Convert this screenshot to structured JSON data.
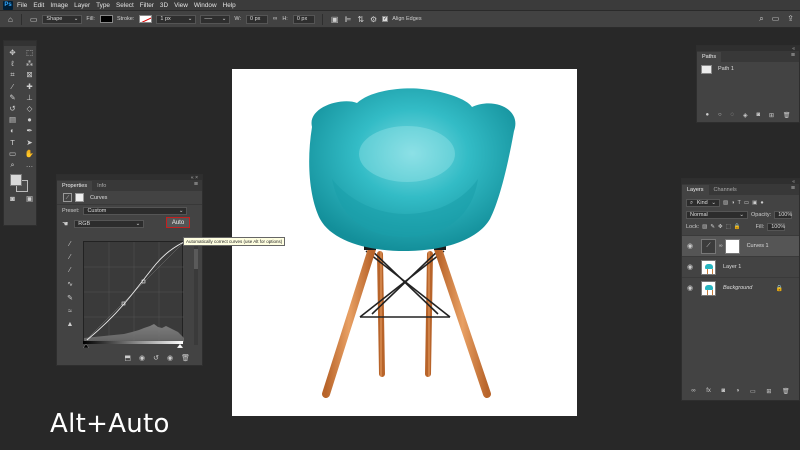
{
  "menubar": {
    "logo": "Ps",
    "items": [
      "File",
      "Edit",
      "Image",
      "Layer",
      "Type",
      "Select",
      "Filter",
      "3D",
      "View",
      "Window",
      "Help"
    ]
  },
  "options_bar": {
    "tool_mode": "Shape",
    "fill_label": "Fill:",
    "stroke_label": "Stroke:",
    "stroke_width": "1 px",
    "w_label": "W:",
    "w_value": "0 px",
    "h_label": "H:",
    "h_value": "0 px",
    "align_edges": "Align Edges"
  },
  "properties": {
    "tabs": [
      "Properties",
      "Info"
    ],
    "title": "Curves",
    "preset_label": "Preset:",
    "preset_value": "Custom",
    "channel": "RGB",
    "auto_button": "Auto",
    "tooltip": "Automatically correct curves (use Alt for options)"
  },
  "paths": {
    "title": "Paths",
    "items": [
      "Path 1"
    ]
  },
  "layers": {
    "tabs": [
      "Layers",
      "Channels"
    ],
    "filter": "Kind",
    "blend_mode": "Normal",
    "opacity_label": "Opacity:",
    "opacity_value": "100%",
    "lock_label": "Lock:",
    "fill_label": "Fill:",
    "fill_value": "100%",
    "items": [
      {
        "name": "Curves 1",
        "type": "adjustment"
      },
      {
        "name": "Layer 1",
        "type": "pixel"
      },
      {
        "name": "Background",
        "type": "background"
      }
    ]
  },
  "caption": "Alt+Auto",
  "colors": {
    "chair": "#1fb3bf",
    "legs": "#d7823f",
    "highlight_border": "#c42020"
  }
}
